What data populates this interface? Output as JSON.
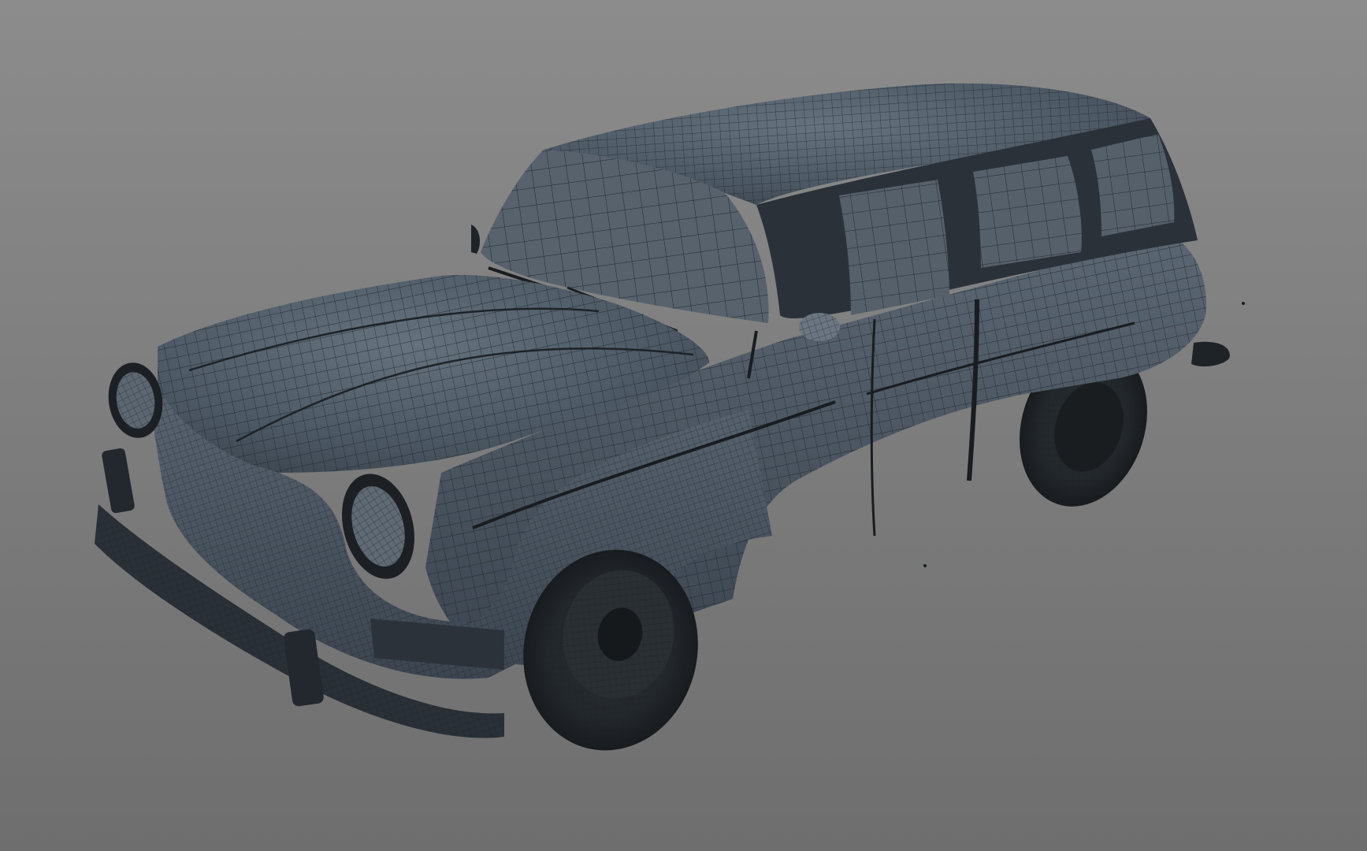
{
  "viewport": {
    "background_top": "#8c8c8c",
    "background_bottom": "#6e6e6e"
  },
  "model": {
    "subject": "station-wagon-car",
    "display_mode": "wireframe-on-shaded",
    "shade_color": "#4a5561",
    "shade_light": "#5e6a76",
    "shade_dark": "#363e47",
    "wire_color": "#1c2126",
    "tire_color": "#1f2326",
    "glass_color": "#56606b"
  }
}
